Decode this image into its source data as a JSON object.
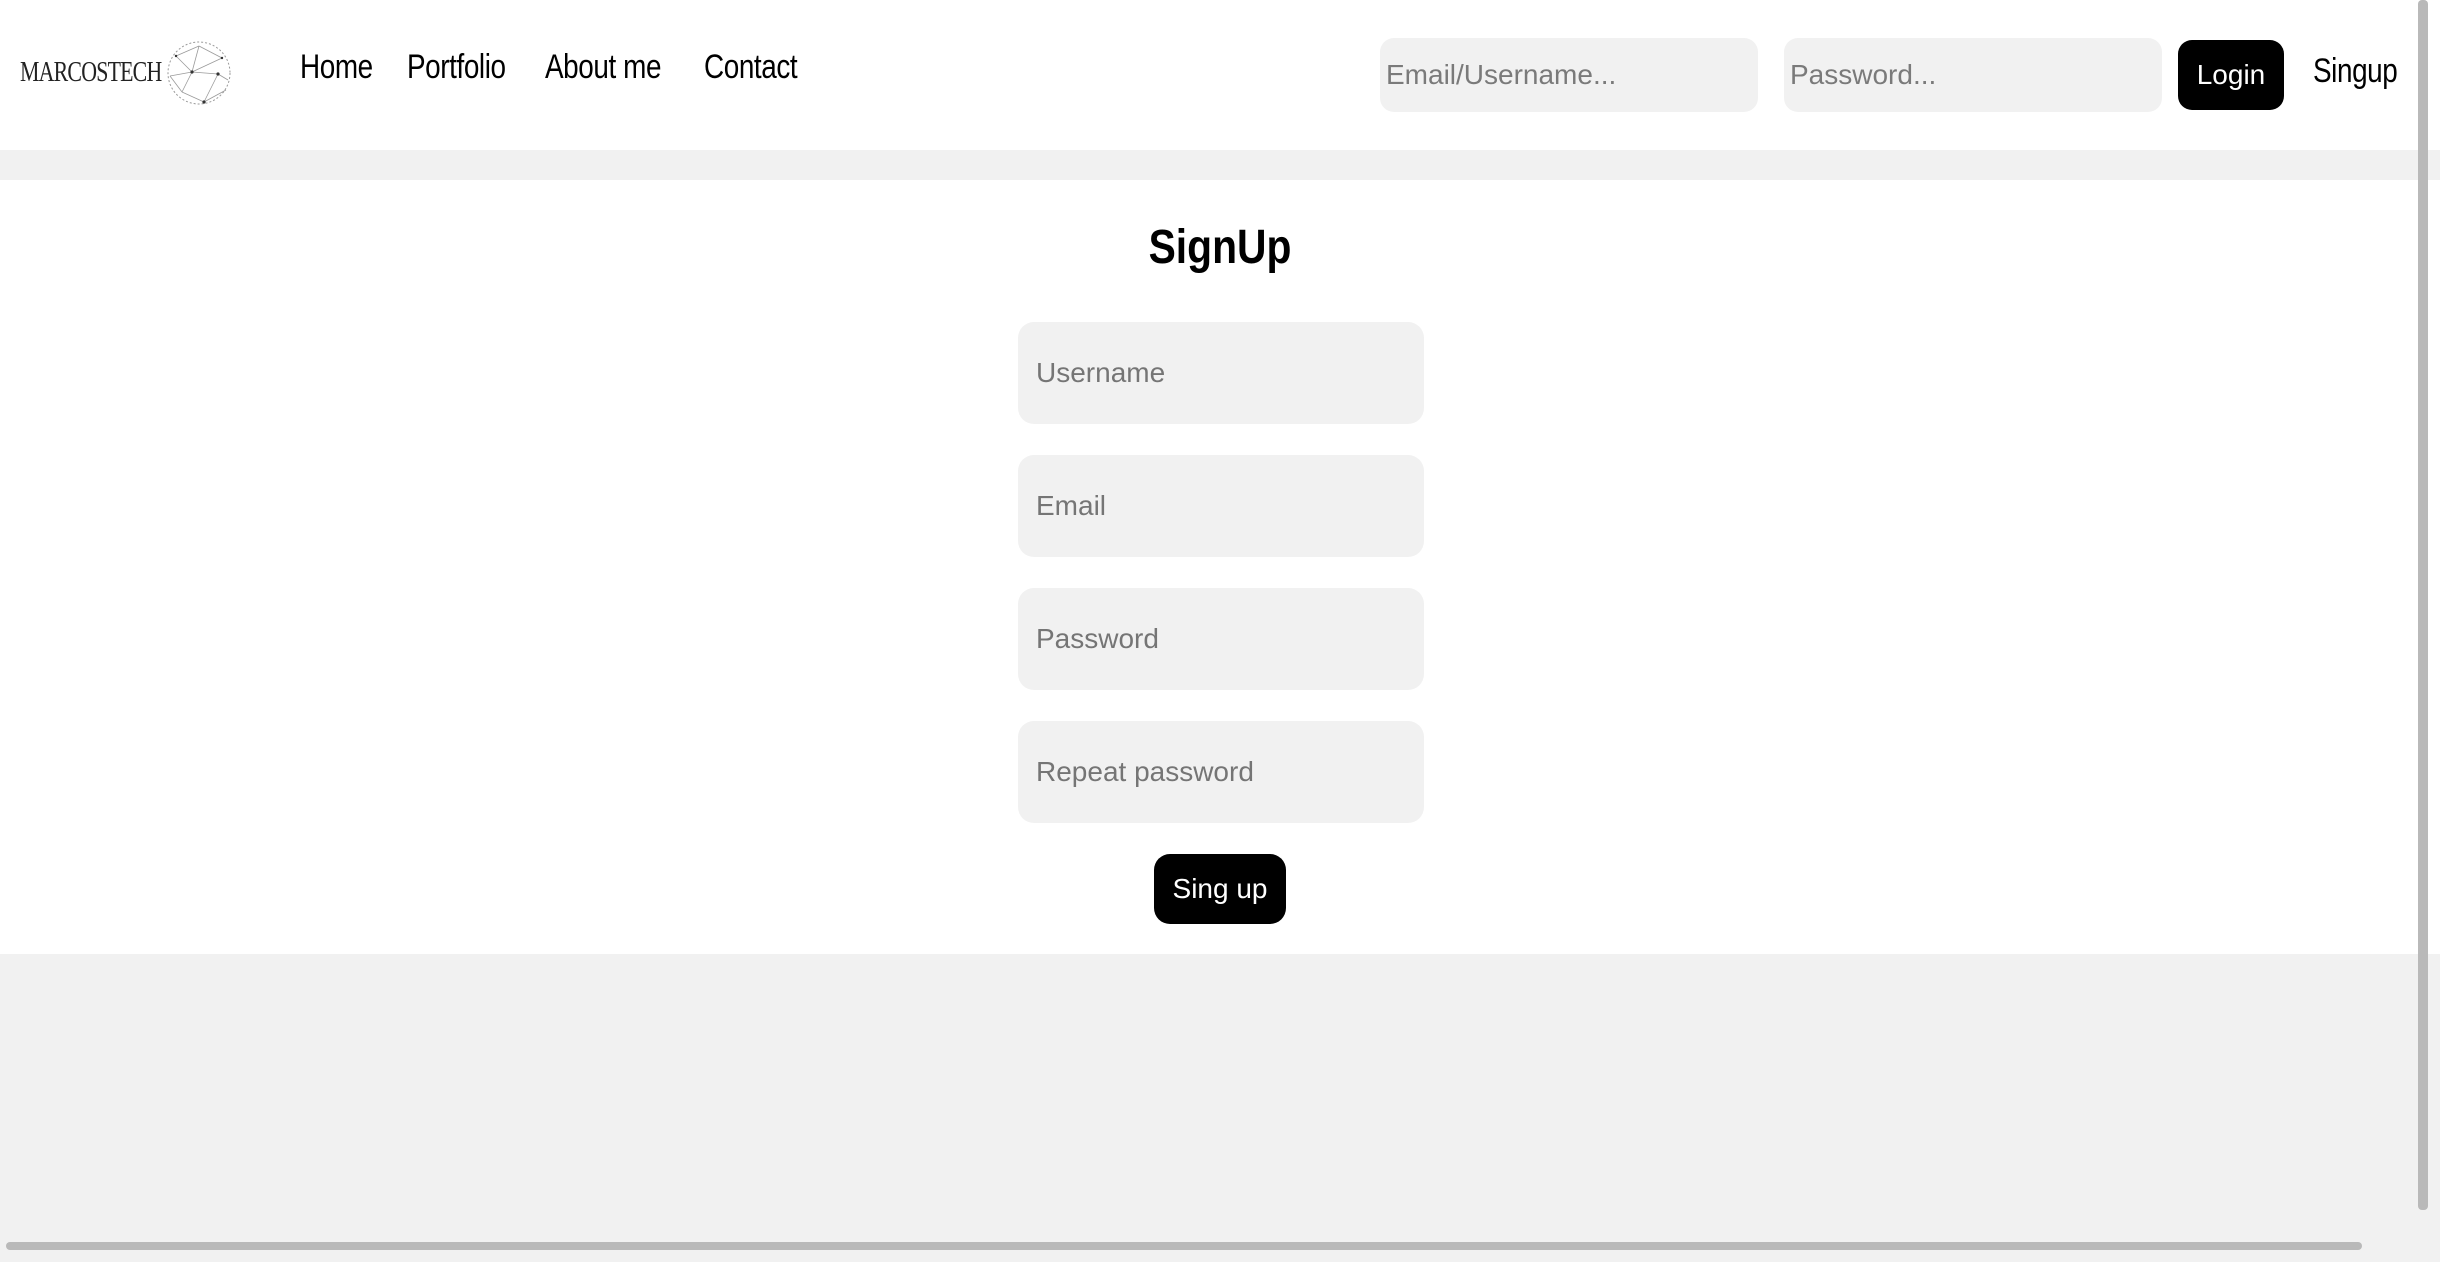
{
  "header": {
    "brand": "MARCOSTECH",
    "nav": [
      "Home",
      "Portfolio",
      "About me",
      "Contact"
    ],
    "login_email_placeholder": "Email/Username...",
    "login_password_placeholder": "Password...",
    "login_label": "Login",
    "signup_label": "Singup"
  },
  "signup_form": {
    "title": "SignUp",
    "username_placeholder": "Username",
    "email_placeholder": "Email",
    "password_placeholder": "Password",
    "repeat_password_placeholder": "Repeat password",
    "submit_label": "Sing up"
  },
  "colors": {
    "page_background": "#f1f1f1",
    "surface": "#ffffff",
    "button": "#000000",
    "input_background": "#f1f1f1"
  },
  "icons": {
    "brand_logo": "globe-network-icon"
  }
}
